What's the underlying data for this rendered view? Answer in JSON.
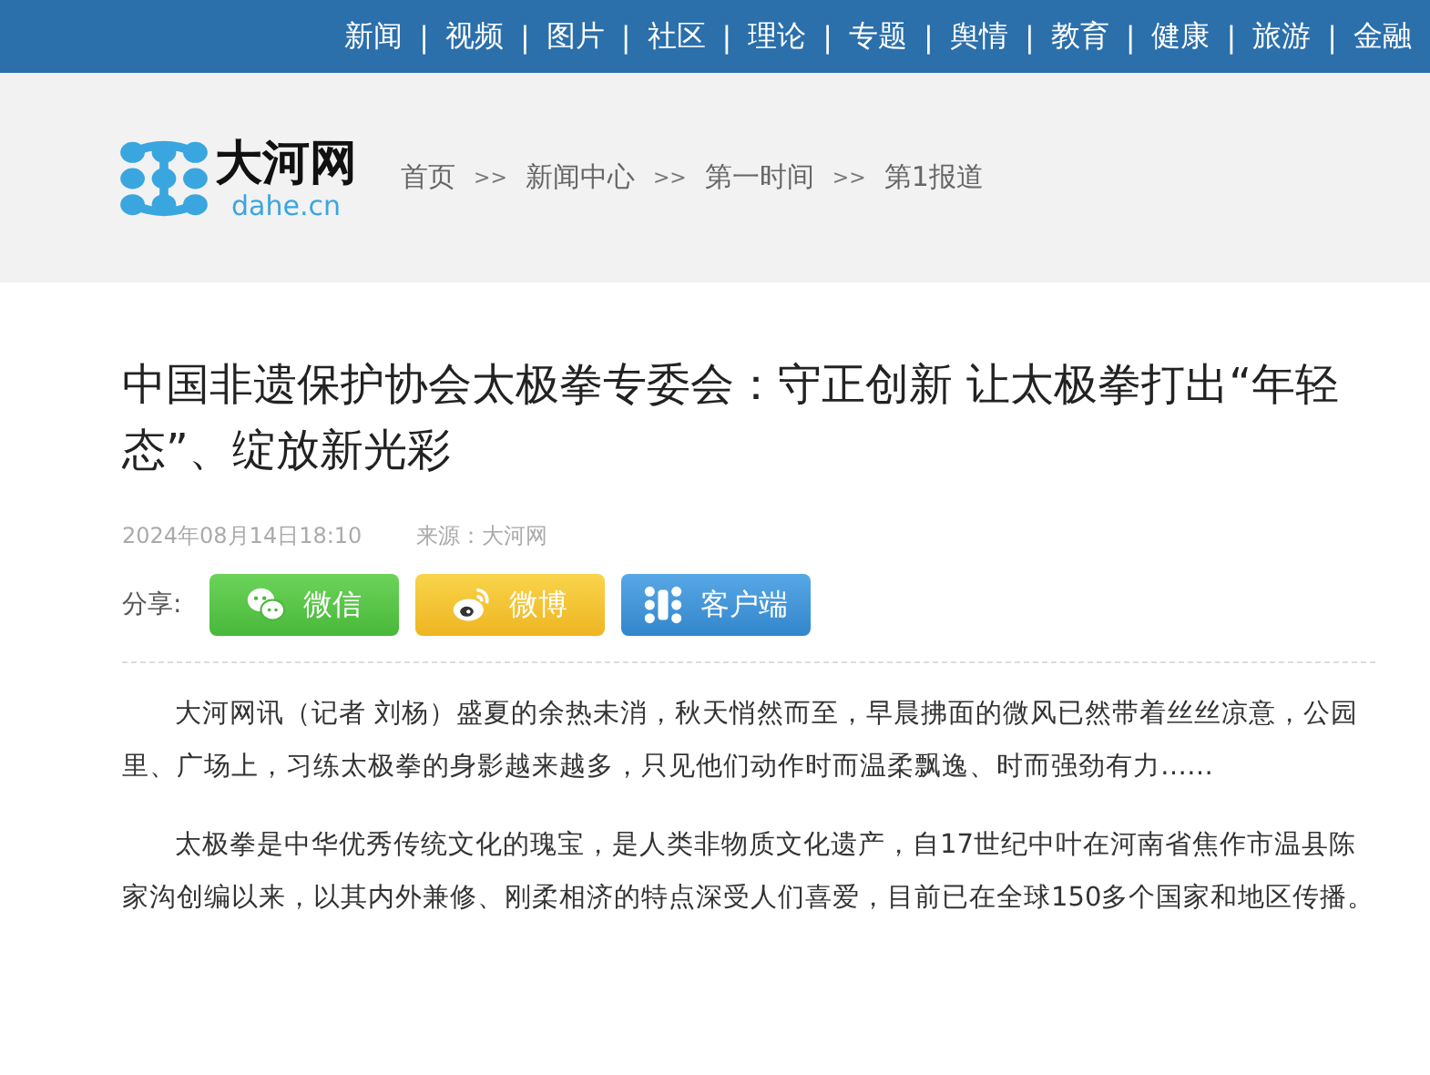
{
  "nav": {
    "items": [
      {
        "label": "新闻"
      },
      {
        "label": "视频"
      },
      {
        "label": "图片"
      },
      {
        "label": "社区"
      },
      {
        "label": "理论"
      },
      {
        "label": "专题"
      },
      {
        "label": "舆情"
      },
      {
        "label": "教育"
      },
      {
        "label": "健康"
      },
      {
        "label": "旅游"
      },
      {
        "label": "金融"
      }
    ],
    "separator": "|"
  },
  "logo": {
    "name": "大河网",
    "domain": "dahe.cn"
  },
  "breadcrumb": {
    "items": [
      "首页",
      "新闻中心",
      "第一时间",
      "第1报道"
    ],
    "separator": ">>"
  },
  "article": {
    "title": "中国非遗保护协会太极拳专委会：守正创新 让太极拳打出“年轻态”、绽放新光彩",
    "date": "2024年08月14日18:10",
    "source": "来源：大河网",
    "share": {
      "label": "分享:",
      "buttons": [
        {
          "kind": "wechat",
          "label": "微信"
        },
        {
          "kind": "weibo",
          "label": "微博"
        },
        {
          "kind": "app",
          "label": "客户端"
        }
      ]
    },
    "paragraphs": [
      "大河网讯（记者 刘杨）盛夏的余热未消，秋天悄然而至，早晨拂面的微风已然带着丝丝凉意，公园里、广场上，习练太极拳的身影越来越多，只见他们动作时而温柔飘逸、时而强劲有力……",
      "太极拳是中华优秀传统文化的瑰宝，是人类非物质文化遗产，自17世纪中叶在河南省焦作市温县陈家沟创编以来，以其内外兼修、刚柔相济的特点深受人们喜爱，目前已在全球150多个国家和地区传播。"
    ]
  }
}
